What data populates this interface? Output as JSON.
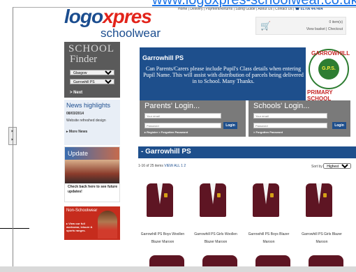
{
  "browser": {
    "url_text": "www.logoxpres-schoolwear.co.uk"
  },
  "logo": {
    "part1": "logo",
    "part2": "xpres",
    "tagline": "schoolwear"
  },
  "topnav": {
    "links": "Home | Delivery | Payment/Returns | Sizing Guide | About Us | Contact Us |",
    "phone": "01706 447404"
  },
  "basket": {
    "items": "0 item(s)",
    "links": "View basket | Checkout"
  },
  "finder": {
    "title1": "SCHOOL",
    "title2": "Finder",
    "select1": "Glasgow",
    "select2": "Garrowhill PS",
    "next": "> Next"
  },
  "news": {
    "heading": "News highlights",
    "date": "08/03/2014",
    "text": "Website refreshed design",
    "more": "▸ More News"
  },
  "update": {
    "title": "Update",
    "text": "Check back here to see future updates!"
  },
  "non_schoolwear": {
    "title": "Non-Schoolwear",
    "text": "▸ View our full workwear, leisure & sports ranges."
  },
  "banner": {
    "heading": "Garrowhill PS",
    "text": "Can Parents/Carers please include Pupil's Class details when entering Pupil Name. This will assist with distribution of parcels being delivered in to School. Many Thanks."
  },
  "school_badge": {
    "top": "GARROWHILL",
    "center": "G.P.S.",
    "bottom": "PRIMARY SCHOOL"
  },
  "parents_login": {
    "title": "Parents' Login...",
    "email_placeholder": "Your email",
    "password_placeholder": "Password",
    "button": "Login",
    "links": "▸ Register > Forgotten Password"
  },
  "schools_login": {
    "title": "Schools' Login...",
    "email_placeholder": "Your email",
    "password_placeholder": "Password",
    "button": "Login",
    "links": "> Forgotten Password"
  },
  "section": {
    "title": "- Garrowhill PS"
  },
  "listing": {
    "count": "1-16 of 25 items",
    "view_all": "VIEW ALL 1 2",
    "sort_label": "Sort by",
    "sort_value": "Highest Price"
  },
  "products": [
    {
      "name_line1": "Garrowhill PS Boys Woollen",
      "name_line2": "Blazer Maroon"
    },
    {
      "name_line1": "Garrowhill PS Girls Woollen",
      "name_line2": "Blazer Maroon"
    },
    {
      "name_line1": "Garrowhill PS Boys Blazer",
      "name_line2": "Maroon"
    },
    {
      "name_line1": "Garrowhill PS Girls Blazer",
      "name_line2": "Maroon"
    }
  ],
  "colors": {
    "brand_blue": "#1e4f8c",
    "accent_red": "#e2231a",
    "maroon": "#5e1523"
  }
}
